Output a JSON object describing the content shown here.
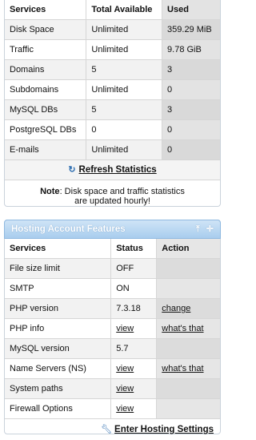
{
  "stats": {
    "headers": [
      "Services",
      "Total Available",
      "Used"
    ],
    "rows": [
      {
        "service": "Disk Space",
        "total": "Unlimited",
        "used": "359.29 MiB"
      },
      {
        "service": "Traffic",
        "total": "Unlimited",
        "used": "9.78 GiB"
      },
      {
        "service": "Domains",
        "total": "5",
        "used": "3"
      },
      {
        "service": "Subdomains",
        "total": "Unlimited",
        "used": "0"
      },
      {
        "service": "MySQL DBs",
        "total": "5",
        "used": "3"
      },
      {
        "service": "PostgreSQL DBs",
        "total": "0",
        "used": "0"
      },
      {
        "service": "E-mails",
        "total": "Unlimited",
        "used": "0"
      }
    ],
    "refresh_label": "Refresh Statistics",
    "note_label": "Note",
    "note_line1": ": Disk space and traffic statistics",
    "note_line2": "are updated hourly!"
  },
  "features": {
    "title": "Hosting Account Features",
    "headers": [
      "Services",
      "Status",
      "Action"
    ],
    "rows": [
      {
        "service": "File size limit",
        "status": "OFF",
        "action": ""
      },
      {
        "service": "SMTP",
        "status": "ON",
        "action": ""
      },
      {
        "service": "PHP version",
        "status": "7.3.18",
        "action": "change"
      },
      {
        "service": "PHP info",
        "status": "view",
        "action": "what's that"
      },
      {
        "service": "MySQL version",
        "status": "5.7",
        "action": ""
      },
      {
        "service": "Name Servers (NS)",
        "status": "view",
        "action": "what's that"
      },
      {
        "service": "System paths",
        "status": "view",
        "action": ""
      },
      {
        "service": "Firewall Options",
        "status": "view",
        "action": ""
      }
    ],
    "enter_label": "Enter Hosting Settings"
  },
  "icons": {
    "refresh": "refresh-icon",
    "pin": "pin-icon",
    "move": "move-icon",
    "wrench": "wrench-icon"
  }
}
